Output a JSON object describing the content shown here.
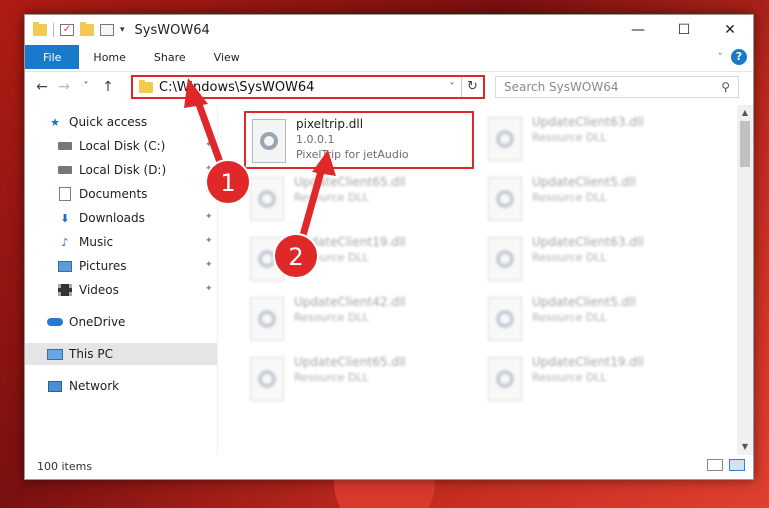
{
  "window": {
    "title": "SysWOW64",
    "controls": {
      "minimize": "—",
      "maximize": "☐",
      "close": "✕"
    }
  },
  "ribbon": {
    "tabs": [
      "File",
      "Home",
      "Share",
      "View"
    ],
    "help": "?"
  },
  "nav": {
    "back": "←",
    "forward": "→",
    "recent": "˅",
    "up": "↑",
    "address": "C:\\Windows\\SysWOW64",
    "refresh": "↻",
    "search_placeholder": "Search SysWOW64"
  },
  "sidebar": {
    "items": [
      {
        "label": "Quick access",
        "icon": "star-icon",
        "pinned": false
      },
      {
        "label": "Local Disk (C:)",
        "icon": "drive-icon",
        "pinned": true
      },
      {
        "label": "Local Disk (D:)",
        "icon": "drive-icon",
        "pinned": true
      },
      {
        "label": "Documents",
        "icon": "documents-icon",
        "pinned": true
      },
      {
        "label": "Downloads",
        "icon": "download-icon",
        "pinned": true
      },
      {
        "label": "Music",
        "icon": "music-icon",
        "pinned": true
      },
      {
        "label": "Pictures",
        "icon": "pictures-icon",
        "pinned": true
      },
      {
        "label": "Videos",
        "icon": "videos-icon",
        "pinned": true
      },
      {
        "label": "OneDrive",
        "icon": "cloud-icon",
        "pinned": false
      },
      {
        "label": "This PC",
        "icon": "computer-icon",
        "pinned": false,
        "selected": true
      },
      {
        "label": "Network",
        "icon": "network-icon",
        "pinned": false
      }
    ]
  },
  "files": [
    {
      "name": "pixeltrip.dll",
      "line2": "1.0.0.1",
      "line3": "PixelTrip for jetAudio",
      "highlighted": true
    },
    {
      "name": "UpdateClient63.dll",
      "line2": "Resource DLL"
    },
    {
      "name": "UpdateClient65.dll",
      "line2": "Resource DLL"
    },
    {
      "name": "UpdateClient5.dll",
      "line2": "Resource DLL"
    },
    {
      "name": "UpdateClient19.dll",
      "line2": "Resource DLL"
    },
    {
      "name": "UpdateClient63.dll",
      "line2": "Resource DLL"
    },
    {
      "name": "UpdateClient42.dll",
      "line2": "Resource DLL"
    },
    {
      "name": "UpdateClient5.dll",
      "line2": "Resource DLL"
    },
    {
      "name": "UpdateClient65.dll",
      "line2": "Resource DLL"
    },
    {
      "name": "UpdateClient19.dll",
      "line2": "Resource DLL"
    }
  ],
  "status": {
    "count": "100 items"
  },
  "annotations": {
    "step1": "1",
    "step2": "2",
    "color": "#e02828"
  }
}
